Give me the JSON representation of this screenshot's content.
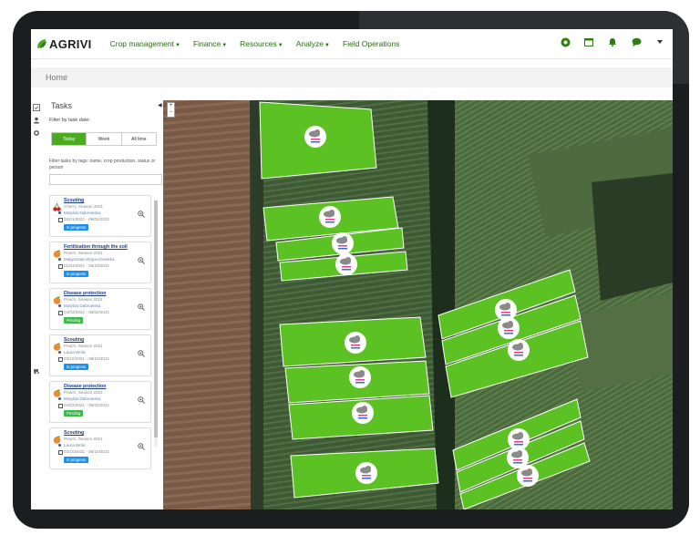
{
  "brand": {
    "name": "AGRIVI",
    "accent": "#4caa1f",
    "link_color": "#2a6b12"
  },
  "nav": {
    "menu": [
      {
        "label": "Crop management",
        "has_caret": true
      },
      {
        "label": "Finance",
        "has_caret": true
      },
      {
        "label": "Resources",
        "has_caret": true
      },
      {
        "label": "Analyze",
        "has_caret": true
      },
      {
        "label": "Field Operations",
        "has_caret": false
      }
    ],
    "icons": [
      "globe-icon",
      "calendar-icon",
      "bell-icon",
      "chat-icon",
      "user-dropdown-caret-icon"
    ]
  },
  "breadcrumb": "Home",
  "rail_icons": [
    "tasks-icon",
    "person-location-icon",
    "settings-icon",
    "tractor-icon"
  ],
  "sidebar": {
    "title": "Tasks",
    "filter_date_label": "Filter by task date:",
    "date_tabs": [
      {
        "label": "Today",
        "active": true
      },
      {
        "label": "Week",
        "active": false
      },
      {
        "label": "All time",
        "active": false
      }
    ],
    "filter_tags_label": "Filter tasks by tags: name, crop production, status or person",
    "search_placeholder": ""
  },
  "tasks": [
    {
      "title": "Scouting",
      "crop": "Cherry, Season 2021",
      "person": "Matylda Dabrowska",
      "dates": "03/01/2021 - 09/01/2021",
      "status": "In progress",
      "status_type": "progress",
      "fruit": "cherry"
    },
    {
      "title": "Fertilization through the soil",
      "crop": "Peach, Season 2021",
      "person": "Malgorzata Wojciechowska",
      "dates": "01/03/2021 - 05/23/2021",
      "status": "In progress",
      "status_type": "progress",
      "fruit": "peach"
    },
    {
      "title": "Disease protection",
      "crop": "Peach, Season 2021",
      "person": "Matylda Dabrowska",
      "dates": "04/02/2021 - 05/02/2021",
      "status": "Pending",
      "status_type": "pending",
      "fruit": "peach"
    },
    {
      "title": "Scouting",
      "crop": "Peach, Season 2021",
      "person": "Laura Wolic",
      "dates": "03/10/2021 - 05/10/2021",
      "status": "In progress",
      "status_type": "progress",
      "fruit": "peach"
    },
    {
      "title": "Disease protection",
      "crop": "Peach, Season 2021",
      "person": "Matylda Dabrowska",
      "dates": "04/02/2021 - 06/02/2021",
      "status": "Pending",
      "status_type": "pending",
      "fruit": "peach"
    },
    {
      "title": "Scouting",
      "crop": "Peach, Season 2021",
      "person": "Laura Wolic",
      "dates": "03/10/2021 - 05/10/2021",
      "status": "In progress",
      "status_type": "progress",
      "fruit": "peach"
    }
  ],
  "map": {
    "zoom_in": "+",
    "zoom_out": "−",
    "field_color": "#5cc224",
    "weather_marker_count": 14
  }
}
